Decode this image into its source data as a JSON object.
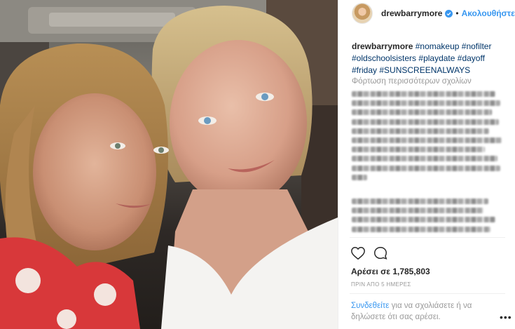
{
  "post": {
    "username": "drewbarrymore",
    "follow_label": "Ακολουθήστε",
    "separator": "•",
    "caption_user": "drewbarrymore",
    "hashtags": [
      "#nomakeup",
      "#nofilter",
      "#oldschoolsisters",
      "#playdate",
      "#dayoff",
      "#friday",
      "#SUNSCREENALWAYS"
    ],
    "load_more_label": "Φόρτωση περισσότερων σχολίων",
    "likes_label": "Αρέσει σε 1,785,803",
    "timestamp": "ΠΡΙΝ ΑΠΟ 5 ΗΜΕΡΕΣ",
    "login_link": "Συνδεθείτε",
    "login_rest": " για να σχολιάσετε ή να δηλώσετε ότι σας αρέσει.",
    "more_options": "•••"
  },
  "icons": {
    "verified": "verified-badge-icon",
    "like": "heart-icon",
    "comment": "comment-bubble-icon",
    "avatar": "profile-avatar"
  },
  "colors": {
    "link_blue": "#3897f0",
    "hashtag_blue": "#003569",
    "muted_gray": "#999999",
    "text_dark": "#262626"
  }
}
